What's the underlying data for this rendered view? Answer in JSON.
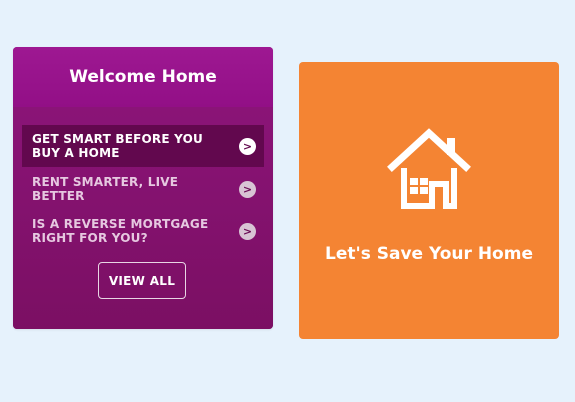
{
  "welcome": {
    "title": "Welcome Home",
    "articles": [
      {
        "line1": "GET SMART BEFORE YOU",
        "line2": "BUY A HOME",
        "arrow": ">"
      },
      {
        "line1": "RENT SMARTER, LIVE",
        "line2": "BETTER",
        "arrow": ">"
      },
      {
        "line1": "IS A REVERSE MORTGAGE",
        "line2": "RIGHT FOR YOU?",
        "arrow": ">"
      }
    ],
    "view_all_label": "VIEW ALL"
  },
  "save_card": {
    "icon": "house-icon",
    "label": "Let's Save Your Home"
  },
  "colors": {
    "page_bg": "#e6f2fc",
    "welcome_header": "#9b1690",
    "welcome_body": "#861369",
    "active_item": "#62084e",
    "save_card": "#f48433"
  }
}
